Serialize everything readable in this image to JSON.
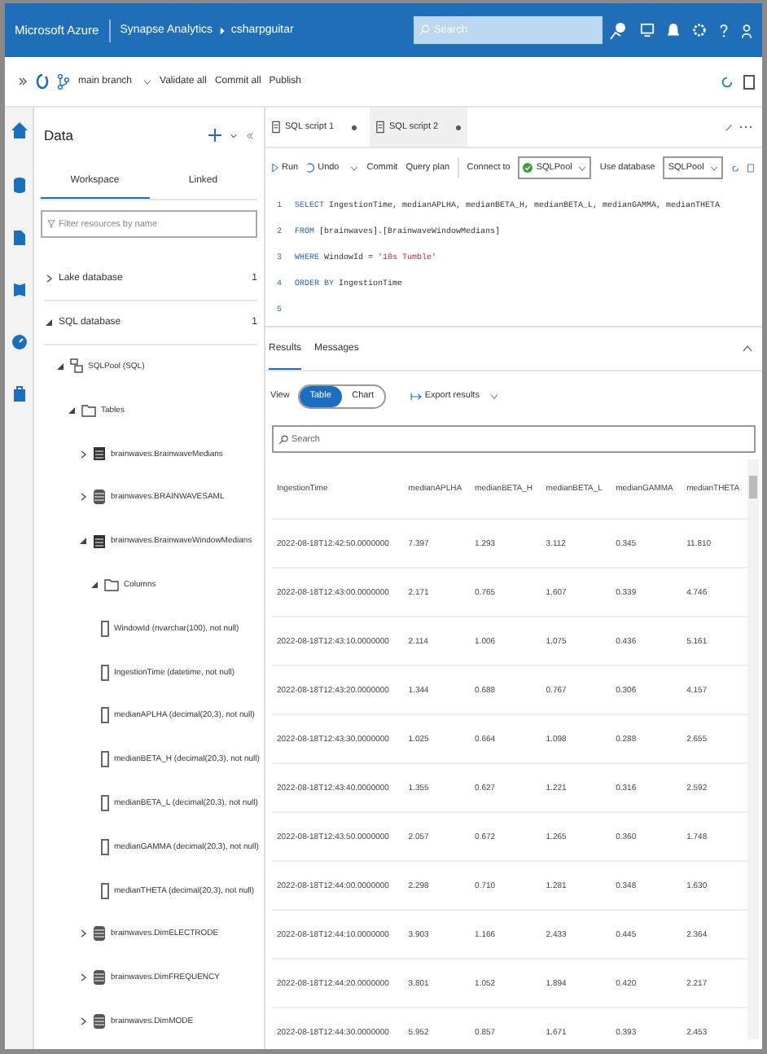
{
  "header": {
    "brand": "Microsoft Azure",
    "service": "Synapse Analytics",
    "workspace": "csharpguitar",
    "search_placeholder": "Search"
  },
  "toolbar": {
    "branch": "main branch",
    "actions": [
      "Validate all",
      "Commit all",
      "Publish"
    ]
  },
  "data_panel": {
    "title": "Data",
    "tabs": [
      {
        "label": "Workspace",
        "selected": true
      },
      {
        "label": "Linked",
        "selected": false
      }
    ],
    "filter_placeholder": "Filter resources by name",
    "tree": [
      {
        "label": "Lake database",
        "kind": "category",
        "count": "1",
        "expanded": false
      },
      {
        "label": "SQL database",
        "kind": "category",
        "count": "1",
        "expanded": true,
        "children": [
          {
            "label": "SQLPool (SQL)",
            "kind": "pool",
            "expanded": true,
            "children": [
              {
                "label": "Tables",
                "kind": "folder",
                "expanded": true,
                "children": [
                  {
                    "label": "brainwaves.BrainwaveMedians",
                    "kind": "table",
                    "expanded": false
                  },
                  {
                    "label": "brainwaves.BRAINWAVESAML",
                    "kind": "external",
                    "expanded": false
                  },
                  {
                    "label": "brainwaves.BrainwaveWindowMedians",
                    "kind": "table",
                    "expanded": true,
                    "children": [
                      {
                        "label": "Columns",
                        "kind": "folder",
                        "expanded": true,
                        "children": [
                          {
                            "label": "WindowId (nvarchar(100), not null)",
                            "kind": "column"
                          },
                          {
                            "label": "IngestionTime (datetime, not null)",
                            "kind": "column"
                          },
                          {
                            "label": "medianAPLHA (decimal(20,3), not null)",
                            "kind": "column"
                          },
                          {
                            "label": "medianBETA_H (decimal(20,3), not null)",
                            "kind": "column"
                          },
                          {
                            "label": "medianBETA_L (decimal(20,3), not null)",
                            "kind": "column"
                          },
                          {
                            "label": "medianGAMMA (decimal(20,3), not null)",
                            "kind": "column"
                          },
                          {
                            "label": "medianTHETA (decimal(20,3), not null)",
                            "kind": "column"
                          }
                        ]
                      }
                    ]
                  },
                  {
                    "label": "brainwaves.DimELECTRODE",
                    "kind": "external",
                    "expanded": false
                  },
                  {
                    "label": "brainwaves.DimFREQUENCY",
                    "kind": "external",
                    "expanded": false
                  },
                  {
                    "label": "brainwaves.DimMODE",
                    "kind": "external",
                    "expanded": false
                  }
                ]
              }
            ]
          }
        ]
      }
    ]
  },
  "editor_tabs": [
    {
      "label": "SQL script 1",
      "selected": false
    },
    {
      "label": "SQL script 2",
      "selected": true
    }
  ],
  "editor_toolbar": {
    "run": "Run",
    "undo": "Undo",
    "commit": "Commit",
    "query_plan": "Query plan",
    "connect_label": "Connect to",
    "connect_value": "SQLPool",
    "database_label": "Use database",
    "database_value": "SQLPool"
  },
  "code": [
    {
      "number": "1",
      "tokens": [
        {
          "kind": "keyword",
          "text": "SELECT"
        },
        {
          "kind": "plain",
          "text": " IngestionTime, medianAPLHA, medianBETA_H, medianBETA_L, medianGAMMA, medianTHETA"
        }
      ]
    },
    {
      "number": "2",
      "tokens": [
        {
          "kind": "keyword",
          "text": "FROM"
        },
        {
          "kind": "plain",
          "text": " [brainwaves].[BrainwaveWindowMedians]"
        }
      ]
    },
    {
      "number": "3",
      "tokens": [
        {
          "kind": "keyword",
          "text": "WHERE"
        },
        {
          "kind": "plain",
          "text": " WindowId = "
        },
        {
          "kind": "string",
          "text": "'10s Tumble'"
        }
      ]
    },
    {
      "number": "4",
      "tokens": [
        {
          "kind": "keyword",
          "text": "ORDER BY"
        },
        {
          "kind": "plain",
          "text": " IngestionTime"
        }
      ]
    },
    {
      "number": "5"
    }
  ],
  "results": {
    "tabs": [
      {
        "label": "Results",
        "selected": true
      },
      {
        "label": "Messages",
        "selected": false
      }
    ],
    "view_label": "View",
    "views": [
      {
        "label": "Table",
        "selected": true
      },
      {
        "label": "Chart",
        "selected": false
      }
    ],
    "export": "Export results",
    "search_placeholder": "Search",
    "columns": [
      "IngestionTime",
      "medianAPLHA",
      "medianBETA_H",
      "medianBETA_L",
      "medianGAMMA",
      "medianTHETA"
    ],
    "rows": [
      [
        "2022-08-18T12:42:50.0000000",
        "7.397",
        "1.293",
        "3.112",
        "0.345",
        "11.810"
      ],
      [
        "2022-08-18T12:43:00.0000000",
        "2.171",
        "0.765",
        "1.607",
        "0.339",
        "4.746"
      ],
      [
        "2022-08-18T12:43:10.0000000",
        "2.114",
        "1.006",
        "1.075",
        "0.436",
        "5.161"
      ],
      [
        "2022-08-18T12:43:20.0000000",
        "1.344",
        "0.688",
        "0.767",
        "0.306",
        "4.157"
      ],
      [
        "2022-08-18T12:43:30.0000000",
        "1.025",
        "0.664",
        "1.098",
        "0.288",
        "2.655"
      ],
      [
        "2022-08-18T12:43:40.0000000",
        "1.355",
        "0.627",
        "1.221",
        "0.316",
        "2.592"
      ],
      [
        "2022-08-18T12:43:50.0000000",
        "2.057",
        "0.672",
        "1.265",
        "0.360",
        "1.748"
      ],
      [
        "2022-08-18T12:44:00.0000000",
        "2.298",
        "0.710",
        "1.281",
        "0.348",
        "1.630"
      ],
      [
        "2022-08-18T12:44:10.0000000",
        "3.903",
        "1.166",
        "2.433",
        "0.445",
        "2.364"
      ],
      [
        "2022-08-18T12:44:20.0000000",
        "3.801",
        "1.052",
        "1.894",
        "0.420",
        "2.217"
      ],
      [
        "2022-08-18T12:44:30.0000000",
        "5.952",
        "0.857",
        "1.671",
        "0.393",
        "2.453"
      ]
    ]
  }
}
